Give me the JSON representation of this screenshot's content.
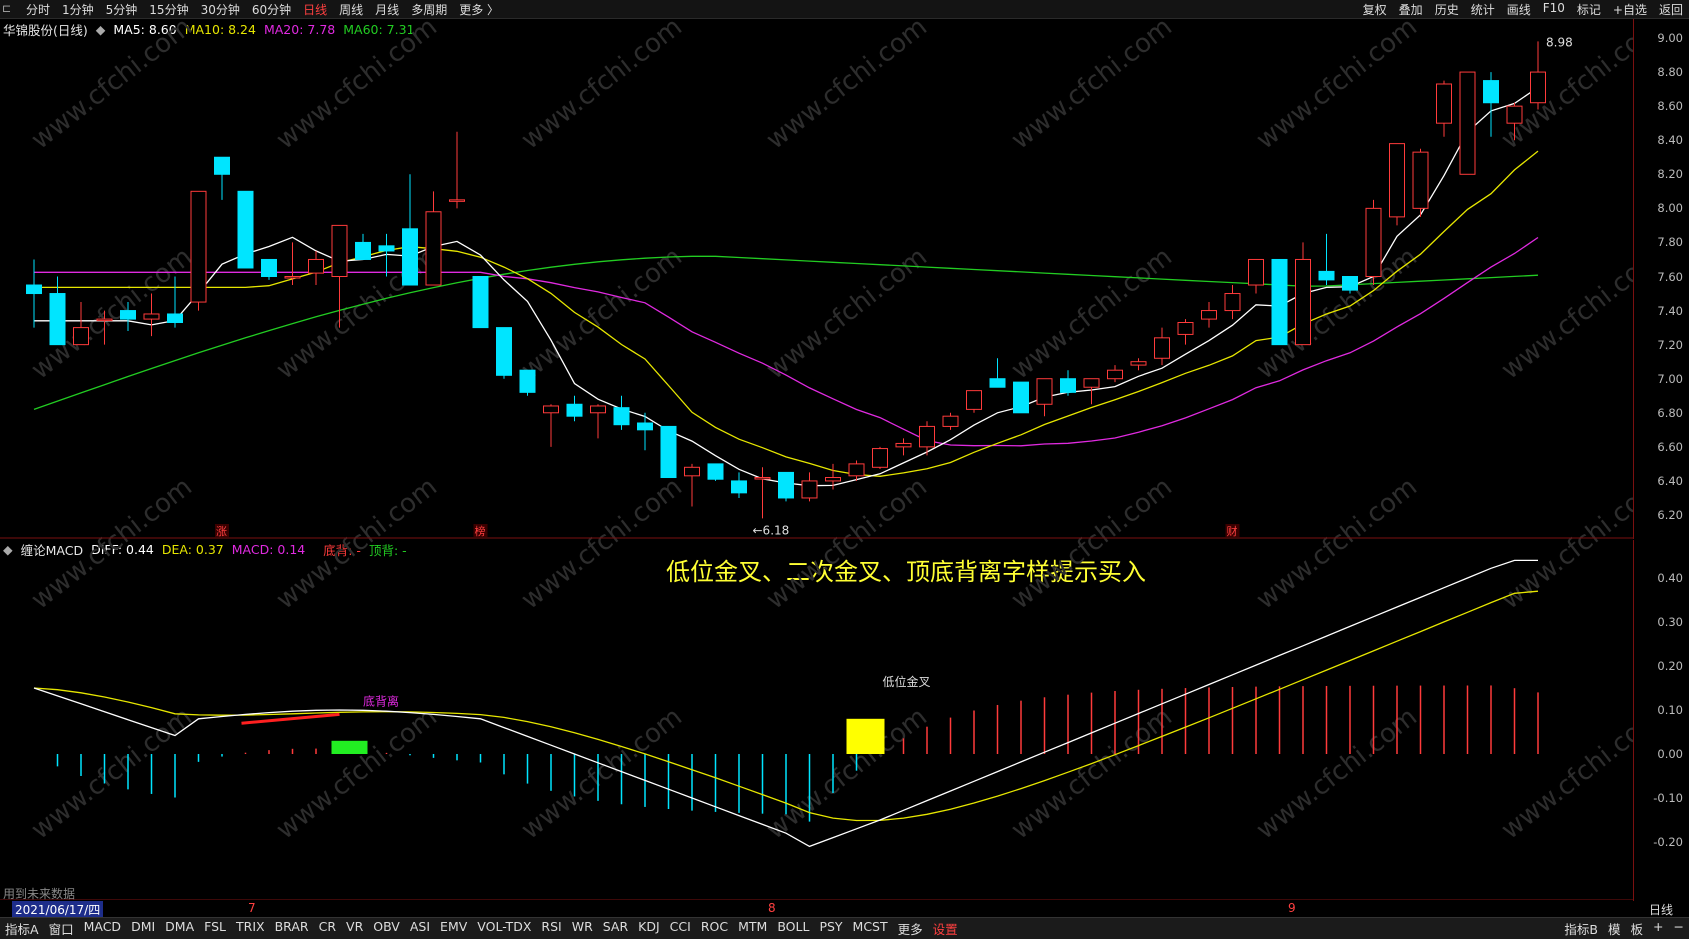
{
  "toolbar": {
    "periods": [
      "分时",
      "1分钟",
      "5分钟",
      "15分钟",
      "30分钟",
      "60分钟",
      "日线",
      "周线",
      "月线",
      "多周期",
      "更多 〉"
    ],
    "active_period": "日线",
    "right_items": [
      "复权",
      "叠加",
      "历史",
      "统计",
      "画线",
      "F10",
      "标记",
      "+自选",
      "返回"
    ]
  },
  "main_chart": {
    "title": "华锦股份(日线)",
    "ma5": "MA5: 8.60",
    "ma10": "MA10: 8.24",
    "ma20": "MA20: 7.78",
    "ma60": "MA60: 7.31",
    "y_ticks": [
      "9.00",
      "8.80",
      "8.60",
      "8.40",
      "8.20",
      "8.00",
      "7.80",
      "7.60",
      "7.40",
      "7.20",
      "7.00",
      "6.80",
      "6.60",
      "6.40",
      "6.20"
    ],
    "high_label": "8.98",
    "low_label": "←6.18",
    "markers": [
      "涨",
      "榜",
      "财"
    ]
  },
  "indicator": {
    "title": "缠论MACD",
    "diff": "DIFF: 0.44",
    "dea": "DEA: 0.37",
    "macd": "MACD: 0.14",
    "bottom_div": "底背: -",
    "top_div": "顶背: -",
    "headline": "低位金叉、二次金叉、顶底背离字样提示买入",
    "label_low_cross": "低位金叉",
    "label_bottom_div": "底背离",
    "y_ticks": [
      "0.40",
      "0.30",
      "0.20",
      "0.10",
      "0.00",
      "-0.10",
      "-0.20"
    ],
    "future_note": "用到未来数据"
  },
  "date_axis": {
    "date": "2021/06/17/四",
    "months": [
      "7",
      "8",
      "9"
    ],
    "period": "日线"
  },
  "bottom_tabs": [
    "指标A",
    "窗口",
    "MACD",
    "DMI",
    "DMA",
    "FSL",
    "TRIX",
    "BRAR",
    "CR",
    "VR",
    "OBV",
    "ASI",
    "EMV",
    "VOL-TDX",
    "RSI",
    "WR",
    "SAR",
    "KDJ",
    "CCI",
    "ROC",
    "MTM",
    "BOLL",
    "PSY",
    "MCST",
    "更多",
    "设置"
  ],
  "bottom_right": [
    "指标B",
    "模",
    "板",
    "+",
    "−"
  ],
  "colors": {
    "up": "#ff3b3b",
    "down": "#00e5ff",
    "ma5": "#ffffff",
    "ma10": "#e6e600",
    "ma20": "#e02ae0",
    "ma60": "#22cc22"
  },
  "watermark": "www.cfchi.com",
  "chart_data": {
    "type": "candlestick",
    "price_range": [
      6.1,
      9.05
    ],
    "candles": [
      [
        7.55,
        7.7,
        7.3,
        7.5
      ],
      [
        7.5,
        7.6,
        7.2,
        7.2
      ],
      [
        7.2,
        7.45,
        7.2,
        7.3
      ],
      [
        7.35,
        7.4,
        7.2,
        7.35
      ],
      [
        7.4,
        7.45,
        7.28,
        7.35
      ],
      [
        7.35,
        7.5,
        7.25,
        7.38
      ],
      [
        7.38,
        7.6,
        7.3,
        7.33
      ],
      [
        7.45,
        8.1,
        7.4,
        8.1
      ],
      [
        8.3,
        8.3,
        8.05,
        8.2
      ],
      [
        8.1,
        8.1,
        7.65,
        7.65
      ],
      [
        7.7,
        7.7,
        7.58,
        7.6
      ],
      [
        7.6,
        7.8,
        7.55,
        7.6
      ],
      [
        7.62,
        7.75,
        7.55,
        7.7
      ],
      [
        7.6,
        7.9,
        7.3,
        7.9
      ],
      [
        7.8,
        7.85,
        7.7,
        7.7
      ],
      [
        7.78,
        7.85,
        7.6,
        7.75
      ],
      [
        7.88,
        8.2,
        7.55,
        7.55
      ],
      [
        7.55,
        8.1,
        7.55,
        7.98
      ],
      [
        8.05,
        8.45,
        8.0,
        8.05
      ],
      [
        7.6,
        7.6,
        7.3,
        7.3
      ],
      [
        7.3,
        7.3,
        7.0,
        7.02
      ],
      [
        7.05,
        7.05,
        6.9,
        6.92
      ],
      [
        6.8,
        6.85,
        6.6,
        6.84
      ],
      [
        6.85,
        6.9,
        6.75,
        6.78
      ],
      [
        6.8,
        6.85,
        6.65,
        6.84
      ],
      [
        6.83,
        6.9,
        6.7,
        6.73
      ],
      [
        6.74,
        6.8,
        6.58,
        6.7
      ],
      [
        6.72,
        6.72,
        6.42,
        6.42
      ],
      [
        6.43,
        6.5,
        6.25,
        6.48
      ],
      [
        6.5,
        6.5,
        6.4,
        6.41
      ],
      [
        6.4,
        6.45,
        6.3,
        6.33
      ],
      [
        6.42,
        6.48,
        6.18,
        6.42
      ],
      [
        6.45,
        6.45,
        6.28,
        6.3
      ],
      [
        6.3,
        6.45,
        6.28,
        6.4
      ],
      [
        6.4,
        6.5,
        6.35,
        6.42
      ],
      [
        6.43,
        6.52,
        6.4,
        6.5
      ],
      [
        6.48,
        6.6,
        6.47,
        6.59
      ],
      [
        6.6,
        6.65,
        6.55,
        6.62
      ],
      [
        6.6,
        6.75,
        6.55,
        6.72
      ],
      [
        6.72,
        6.8,
        6.7,
        6.78
      ],
      [
        6.82,
        6.92,
        6.8,
        6.93
      ],
      [
        7.0,
        7.12,
        6.95,
        6.95
      ],
      [
        6.98,
        6.98,
        6.8,
        6.8
      ],
      [
        6.85,
        7.0,
        6.78,
        7.0
      ],
      [
        7.0,
        7.05,
        6.9,
        6.92
      ],
      [
        6.95,
        7.0,
        6.85,
        7.0
      ],
      [
        7.0,
        7.08,
        6.98,
        7.05
      ],
      [
        7.08,
        7.12,
        7.05,
        7.1
      ],
      [
        7.12,
        7.3,
        7.08,
        7.24
      ],
      [
        7.26,
        7.35,
        7.2,
        7.33
      ],
      [
        7.35,
        7.45,
        7.3,
        7.4
      ],
      [
        7.4,
        7.55,
        7.35,
        7.5
      ],
      [
        7.55,
        7.7,
        7.5,
        7.7
      ],
      [
        7.7,
        7.7,
        7.2,
        7.2
      ],
      [
        7.2,
        7.8,
        7.2,
        7.7
      ],
      [
        7.63,
        7.85,
        7.55,
        7.58
      ],
      [
        7.6,
        7.6,
        7.5,
        7.52
      ],
      [
        7.6,
        8.05,
        7.55,
        8.0
      ],
      [
        7.95,
        8.35,
        7.9,
        8.38
      ],
      [
        8.0,
        8.35,
        7.95,
        8.33
      ],
      [
        8.5,
        8.75,
        8.42,
        8.73
      ],
      [
        8.2,
        8.8,
        8.2,
        8.8
      ],
      [
        8.75,
        8.8,
        8.42,
        8.62
      ],
      [
        8.5,
        8.62,
        8.4,
        8.6
      ],
      [
        8.62,
        8.98,
        8.58,
        8.8
      ]
    ]
  }
}
